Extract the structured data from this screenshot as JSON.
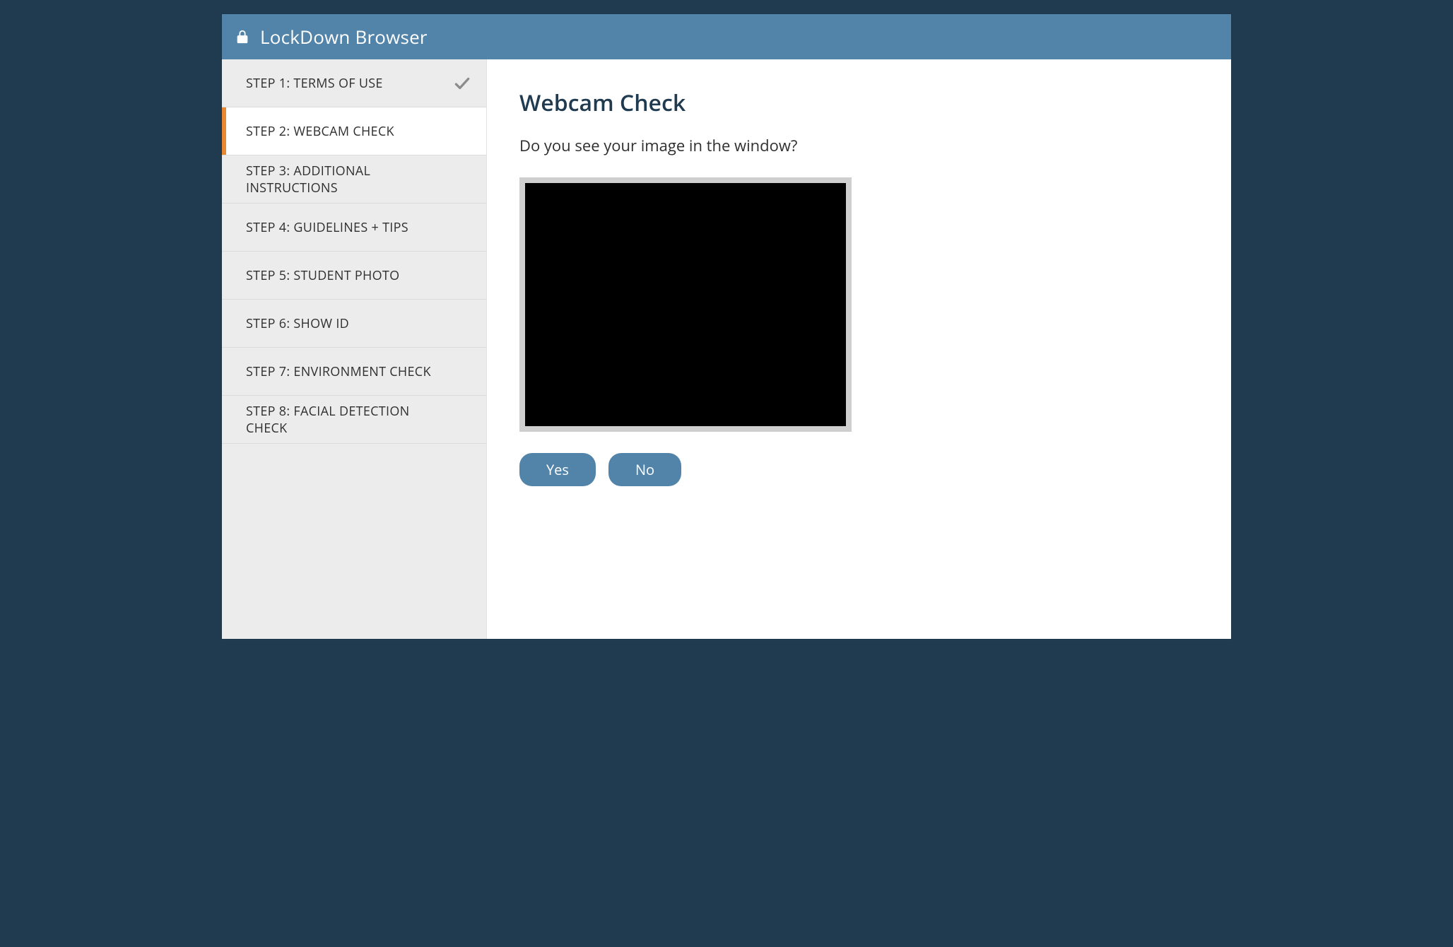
{
  "header": {
    "title": "LockDown Browser"
  },
  "sidebar": {
    "steps": [
      {
        "label": "STEP 1: TERMS OF USE",
        "completed": true,
        "active": false
      },
      {
        "label": "STEP 2: WEBCAM CHECK",
        "completed": false,
        "active": true
      },
      {
        "label": "STEP 3: ADDITIONAL INSTRUCTIONS",
        "completed": false,
        "active": false
      },
      {
        "label": "STEP 4: GUIDELINES + TIPS",
        "completed": false,
        "active": false
      },
      {
        "label": "STEP 5: STUDENT PHOTO",
        "completed": false,
        "active": false
      },
      {
        "label": "STEP 6: SHOW ID",
        "completed": false,
        "active": false
      },
      {
        "label": "STEP 7: ENVIRONMENT CHECK",
        "completed": false,
        "active": false
      },
      {
        "label": "STEP 8: FACIAL DETECTION CHECK",
        "completed": false,
        "active": false
      }
    ]
  },
  "main": {
    "heading": "Webcam Check",
    "prompt": "Do you see your image in the window?",
    "buttons": {
      "yes": "Yes",
      "no": "No"
    }
  },
  "colors": {
    "frame": "#203a4f",
    "header": "#5284aa",
    "accent": "#e78933"
  }
}
